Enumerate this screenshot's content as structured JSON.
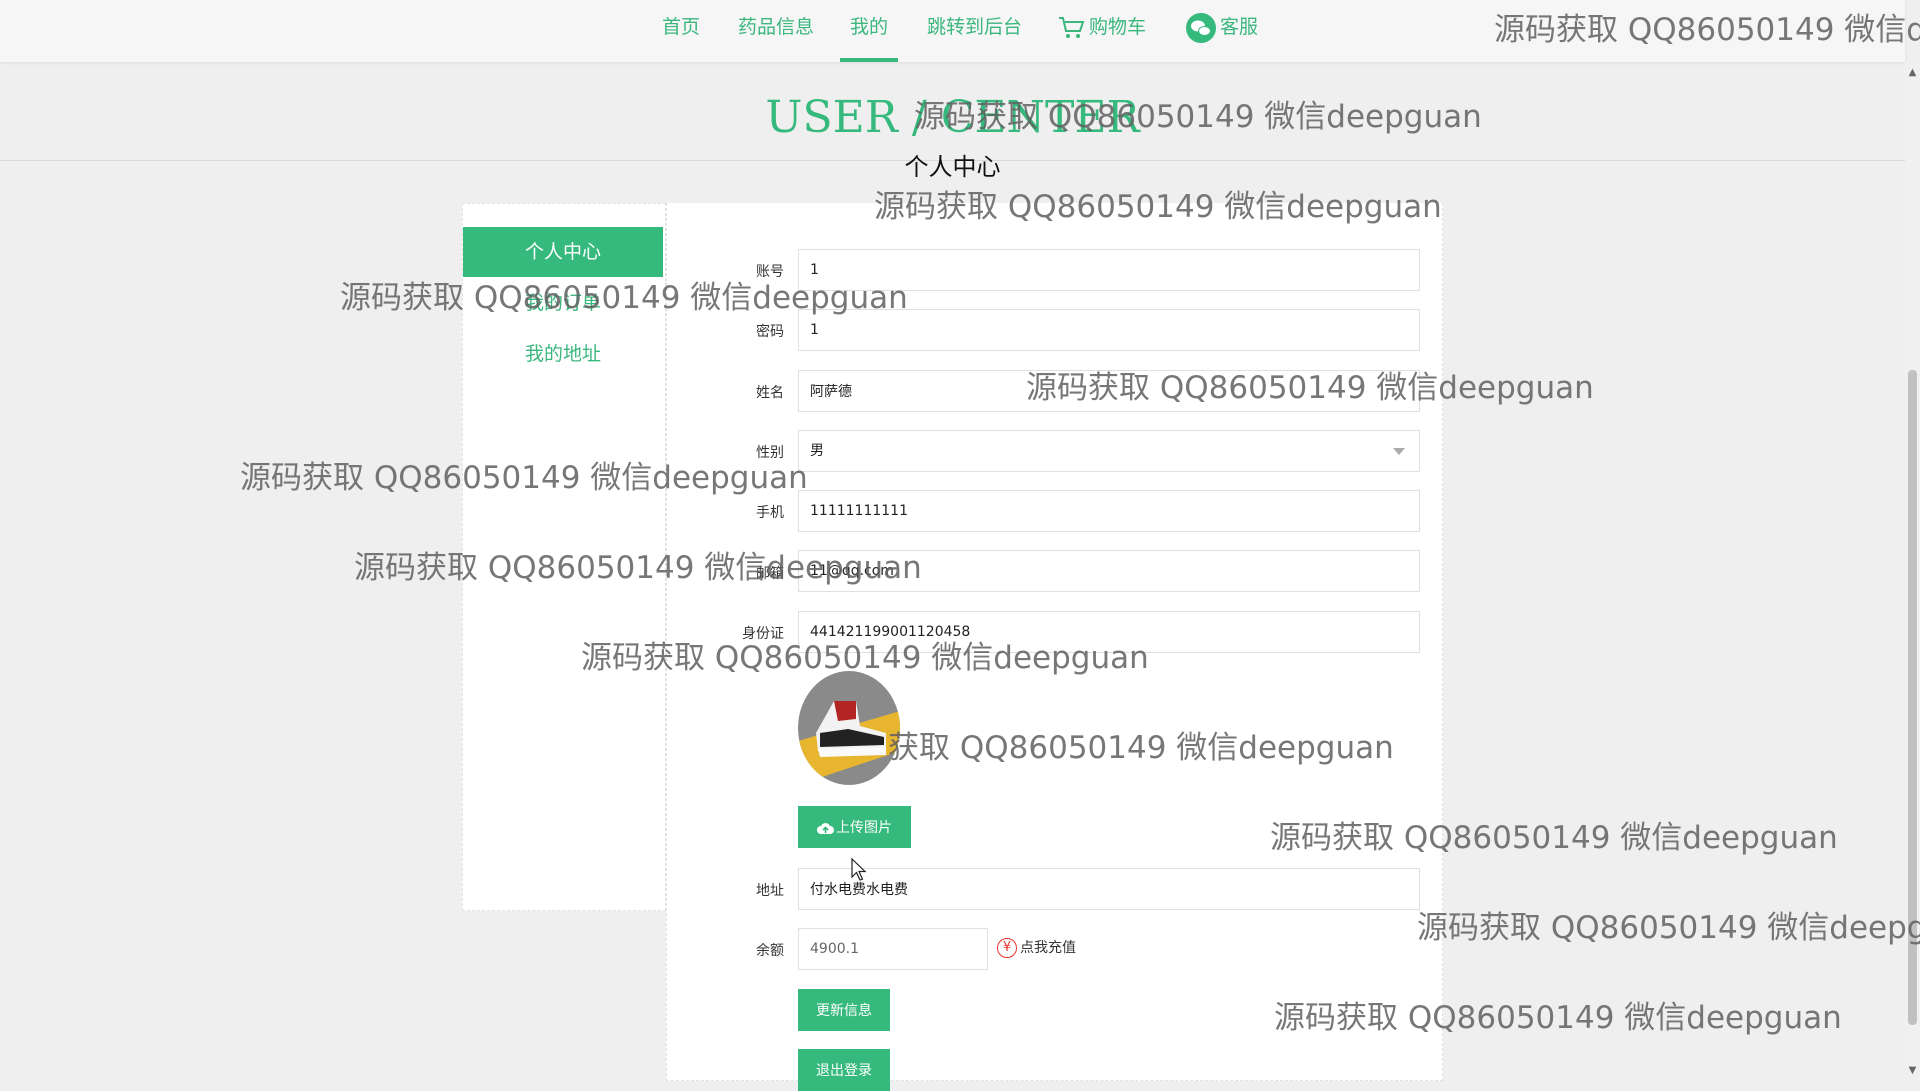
{
  "nav": {
    "items": [
      {
        "label": "首页"
      },
      {
        "label": "药品信息"
      },
      {
        "label": "我的"
      },
      {
        "label": "跳转到后台"
      },
      {
        "label": "购物车"
      },
      {
        "label": "客服"
      }
    ],
    "active": "我的"
  },
  "hero": {
    "title_en": "USER / CENTER",
    "title_cn": "个人中心"
  },
  "sidebar": {
    "items": [
      {
        "label": "个人中心",
        "active": true
      },
      {
        "label": "我的订单",
        "active": false
      },
      {
        "label": "我的地址",
        "active": false
      }
    ]
  },
  "form": {
    "account": {
      "label": "账号",
      "value": "1"
    },
    "password": {
      "label": "密码",
      "value": "1"
    },
    "name": {
      "label": "姓名",
      "value": "阿萨德"
    },
    "gender": {
      "label": "性别",
      "value": "男"
    },
    "phone": {
      "label": "手机",
      "value": "11111111111"
    },
    "email": {
      "label": "邮箱",
      "value": "11@qq.com"
    },
    "id_card": {
      "label": "身份证",
      "value": "441421199001120458"
    },
    "upload_label": "上传图片",
    "address": {
      "label": "地址",
      "value": "付水电费水电费"
    },
    "balance": {
      "label": "余额",
      "value": "4900.1"
    },
    "recharge_label": "点我充值",
    "recharge_symbol": "¥",
    "update_label": "更新信息",
    "logout_label": "退出登录"
  },
  "watermark": {
    "text": "源码获取 QQ86050149 微信deepguan",
    "text_cut": "源码获取 QQ86050149 微信de",
    "text_cut2": "源码获取 QQ86050149 微信deepgu",
    "text_cut3": "获取 QQ86050149 微信deepguan"
  },
  "colors": {
    "accent": "#36b97c",
    "nav_text": "#3bb77e",
    "recharge_icon": "#ee3333"
  }
}
